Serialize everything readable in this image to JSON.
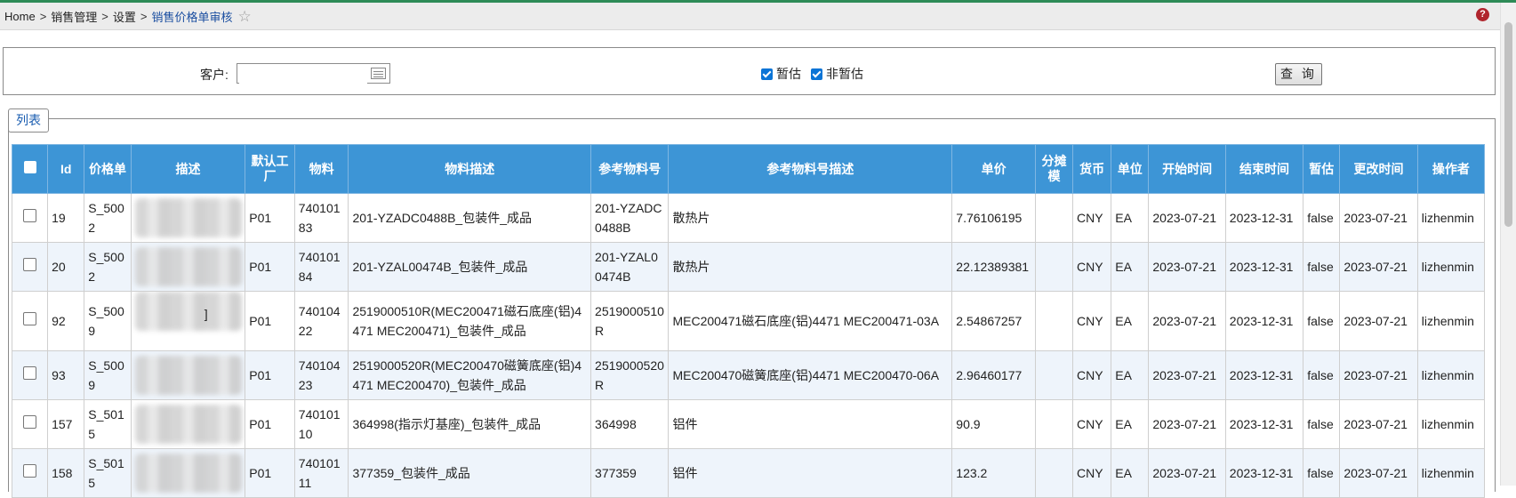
{
  "breadcrumb": {
    "items": [
      "Home",
      "销售管理",
      "设置"
    ],
    "separator": ">",
    "current": "销售价格单审核"
  },
  "search": {
    "customer_label": "客户:",
    "customer_value": "",
    "checkbox_provisional": {
      "label": "暂估",
      "checked": true
    },
    "checkbox_non_provisional": {
      "label": "非暂估",
      "checked": true
    },
    "query_button": "查 询"
  },
  "list": {
    "legend": "列表",
    "columns": [
      "",
      "Id",
      "价格单",
      "描述",
      "默认工厂",
      "物料",
      "物料描述",
      "参考物料号",
      "参考物料号描述",
      "单价",
      "分摊模",
      "货币",
      "单位",
      "开始时间",
      "结束时间",
      "暂估",
      "更改时间",
      "操作者"
    ],
    "rows": [
      {
        "id": "19",
        "price_list": "S_5002",
        "desc": "",
        "plant": "P01",
        "material": "74010183",
        "material_desc": "201-YZADC0488B_包装件_成品",
        "ref_no": "201-YZADC0488B",
        "ref_desc": "散热片",
        "price": "7.76106195",
        "alloc": "",
        "currency": "CNY",
        "unit": "EA",
        "start": "2023-07-21",
        "end": "2023-12-31",
        "provisional": "false",
        "changed": "2023-07-21",
        "operator": "lizhenmin"
      },
      {
        "id": "20",
        "price_list": "S_5002",
        "desc": "",
        "plant": "P01",
        "material": "74010184",
        "material_desc": "201-YZAL00474B_包装件_成品",
        "ref_no": "201-YZAL00474B",
        "ref_desc": "散热片",
        "price": "22.12389381",
        "alloc": "",
        "currency": "CNY",
        "unit": "EA",
        "start": "2023-07-21",
        "end": "2023-12-31",
        "provisional": "false",
        "changed": "2023-07-21",
        "operator": "lizhenmin"
      },
      {
        "id": "92",
        "price_list": "S_5009",
        "desc": "]",
        "plant": "P01",
        "material": "74010422",
        "material_desc": "2519000510R(MEC200471磁石底座(铝)4471 MEC200471)_包装件_成品",
        "ref_no": "2519000510R",
        "ref_desc": "MEC200471磁石底座(铝)4471 MEC200471-03A",
        "price": "2.54867257",
        "alloc": "",
        "currency": "CNY",
        "unit": "EA",
        "start": "2023-07-21",
        "end": "2023-12-31",
        "provisional": "false",
        "changed": "2023-07-21",
        "operator": "lizhenmin"
      },
      {
        "id": "93",
        "price_list": "S_5009",
        "desc": "",
        "plant": "P01",
        "material": "74010423",
        "material_desc": "2519000520R(MEC200470磁簧底座(铝)4471 MEC200470)_包装件_成品",
        "ref_no": "2519000520R",
        "ref_desc": "MEC200470磁簧底座(铝)4471 MEC200470-06A",
        "price": "2.96460177",
        "alloc": "",
        "currency": "CNY",
        "unit": "EA",
        "start": "2023-07-21",
        "end": "2023-12-31",
        "provisional": "false",
        "changed": "2023-07-21",
        "operator": "lizhenmin"
      },
      {
        "id": "157",
        "price_list": "S_5015",
        "desc": "",
        "plant": "P01",
        "material": "74010110",
        "material_desc": "364998(指示灯基座)_包装件_成品",
        "ref_no": "364998",
        "ref_desc": "铝件",
        "price": "90.9",
        "alloc": "",
        "currency": "CNY",
        "unit": "EA",
        "start": "2023-07-21",
        "end": "2023-12-31",
        "provisional": "false",
        "changed": "2023-07-21",
        "operator": "lizhenmin"
      },
      {
        "id": "158",
        "price_list": "S_5015",
        "desc": "",
        "plant": "P01",
        "material": "74010111",
        "material_desc": "377359_包装件_成品",
        "ref_no": "377359",
        "ref_desc": "铝件",
        "price": "123.2",
        "alloc": "",
        "currency": "CNY",
        "unit": "EA",
        "start": "2023-07-21",
        "end": "2023-12-31",
        "provisional": "false",
        "changed": "2023-07-21",
        "operator": "lizhenmin"
      }
    ]
  },
  "colors": {
    "header_bg": "#3d95d6",
    "row_alt": "#eef4fb",
    "link": "#1a4ea0",
    "checkbox": "#0b74d6"
  },
  "icons": {
    "favorite": "star-outline-icon",
    "help": "help-icon",
    "calendar": "calendar-icon"
  }
}
